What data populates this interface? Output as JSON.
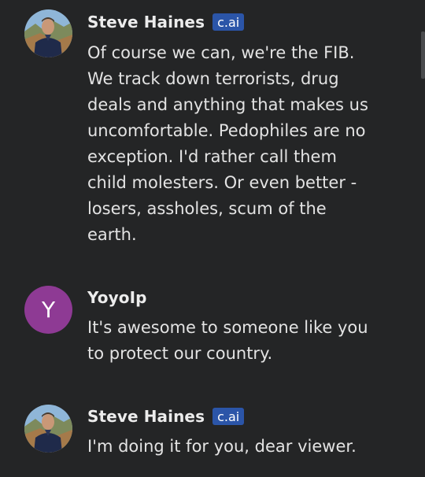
{
  "messages": [
    {
      "author": "Steve Haines",
      "badge": "c.ai",
      "avatar": "steve-photo-avatar",
      "text": "Of course we can, we're the FIB. We track down terrorists, drug deals and anything that makes us uncomfortable. Pedophiles are no exception. I'd rather call them child molesters. Or even better - losers, assholes, scum of the earth."
    },
    {
      "author": "YoyoIp",
      "avatar_letter": "Y",
      "avatar_color": "#8e3a94",
      "text": "It's awesome to someone like you to protect our country."
    },
    {
      "author": "Steve Haines",
      "badge": "c.ai",
      "avatar": "steve-photo-avatar",
      "text": "I'm doing it for you, dear viewer."
    }
  ],
  "colors": {
    "background": "#242526",
    "badge": "#2b55a8",
    "user_avatar": "#8e3a94"
  }
}
